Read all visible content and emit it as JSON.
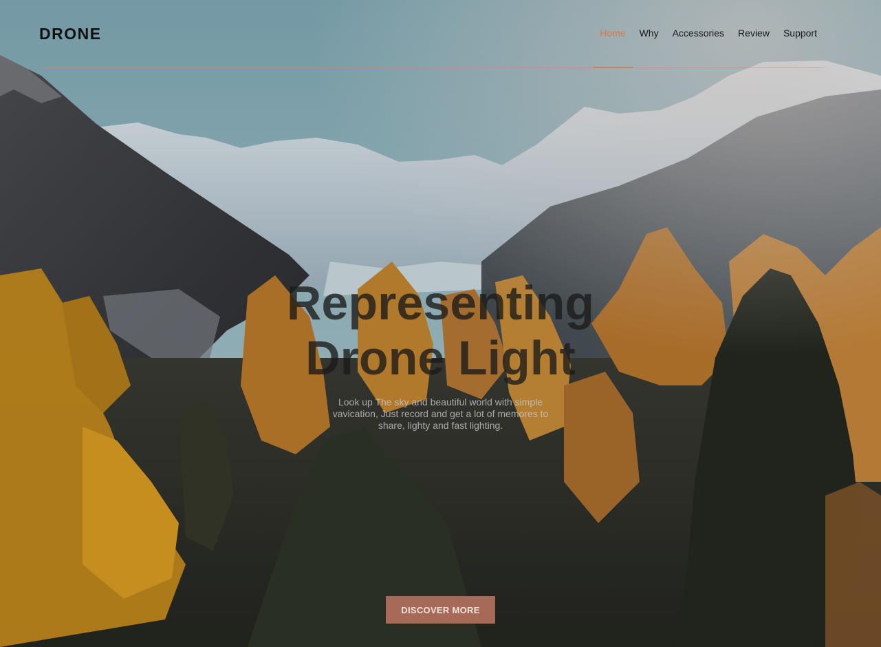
{
  "brand": {
    "logo": "DRONE"
  },
  "nav": {
    "items": [
      {
        "label": "Home",
        "active": true
      },
      {
        "label": "Why",
        "active": false
      },
      {
        "label": "Accessories",
        "active": false
      },
      {
        "label": "Review",
        "active": false
      },
      {
        "label": "Support",
        "active": false
      }
    ]
  },
  "hero": {
    "title_line1": "Representing",
    "title_line2": "Drone Light",
    "description": "Look up The sky and beautiful world with simple vavication, Just record and get a lot of memores to share, lighty and fast lighting.",
    "cta_label": "DISCOVER MORE",
    "background_image": "mountain-landscape-with-autumn-larch-forest"
  },
  "colors": {
    "accent": "#d9774a",
    "cta_background": "#a86a58",
    "logo_text": "#111111"
  }
}
